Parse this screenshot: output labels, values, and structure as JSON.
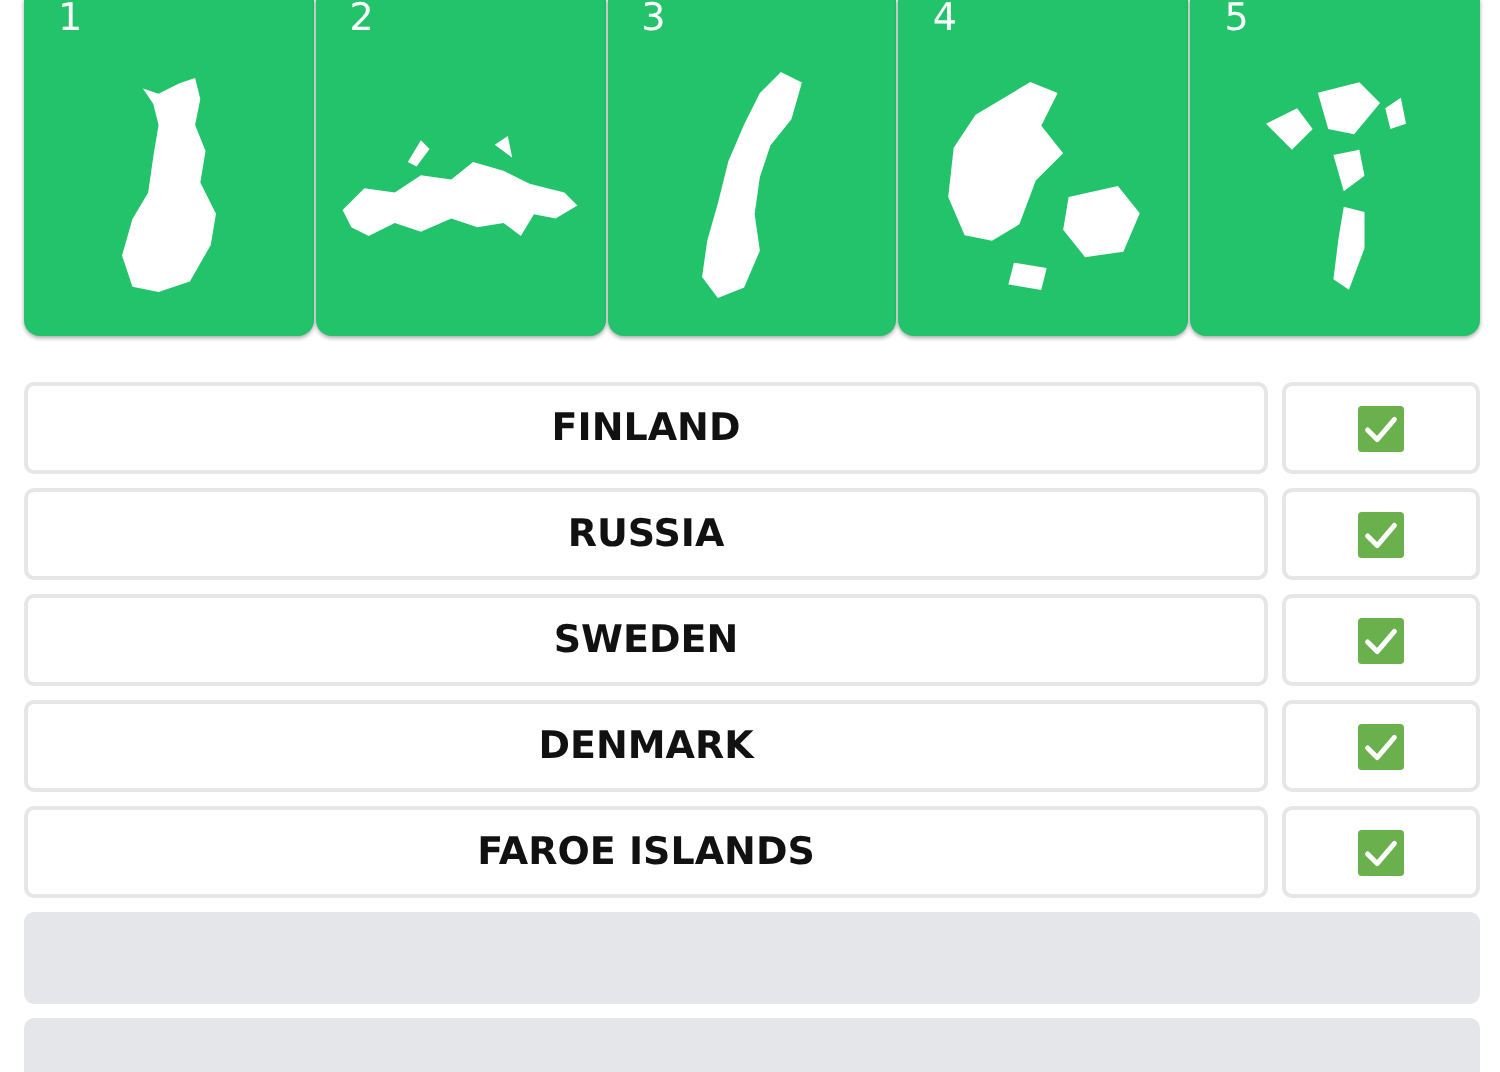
{
  "cards": [
    {
      "number": "1"
    },
    {
      "number": "2"
    },
    {
      "number": "3"
    },
    {
      "number": "4"
    },
    {
      "number": "5"
    }
  ],
  "slots": [
    {
      "kind": "answer",
      "name": "FINLAND",
      "checked": true
    },
    {
      "kind": "answer",
      "name": "RUSSIA",
      "checked": true
    },
    {
      "kind": "answer",
      "name": "SWEDEN",
      "checked": true
    },
    {
      "kind": "answer",
      "name": "DENMARK",
      "checked": true
    },
    {
      "kind": "answer",
      "name": "FAROE ISLANDS",
      "checked": true
    },
    {
      "kind": "empty"
    },
    {
      "kind": "empty"
    }
  ]
}
